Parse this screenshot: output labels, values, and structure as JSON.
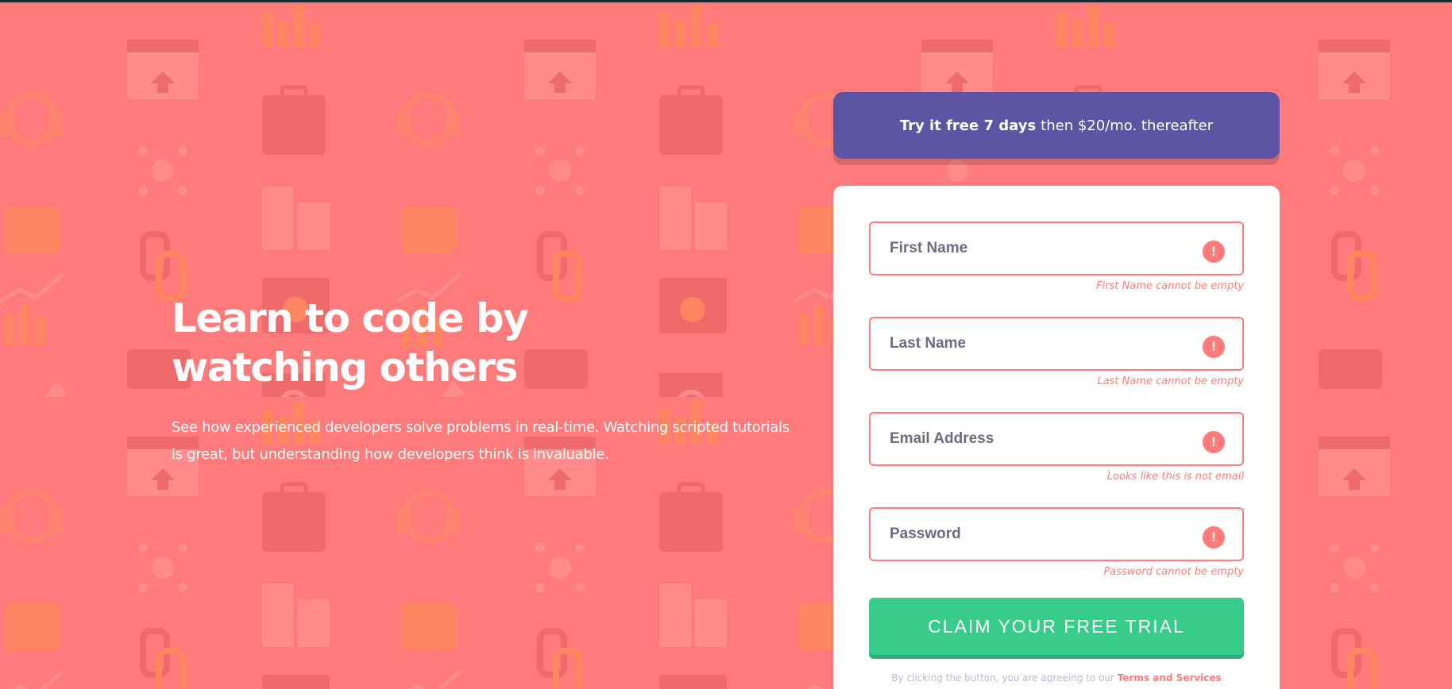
{
  "hero": {
    "title": "Learn to code by watching others",
    "description": "See how experienced developers solve problems in real-time. Watching scripted tutorials is great, but understanding how developers think is invaluable."
  },
  "offer": {
    "bold": "Try it free 7 days",
    "rest": "then $20/mo. thereafter"
  },
  "form": {
    "fields": [
      {
        "placeholder": "First Name",
        "error": "First Name cannot be empty"
      },
      {
        "placeholder": "Last Name",
        "error": "Last Name cannot be empty"
      },
      {
        "placeholder": "Email Address",
        "error": "Looks like this is not email"
      },
      {
        "placeholder": "Password",
        "error": "Password cannot be empty"
      }
    ],
    "error_glyph": "!",
    "submit_label": "CLAIM YOUR FREE TRIAL",
    "terms_prefix": "By clicking the button, you are agreeing to our",
    "terms_link": "Terms and Services"
  },
  "colors": {
    "background": "#ff7a7a",
    "accent_purple": "#5e54a4",
    "accent_green": "#38cc8b",
    "error": "#ff7a7a"
  }
}
